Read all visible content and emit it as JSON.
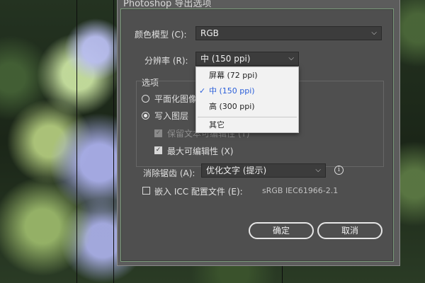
{
  "window": {
    "title": "Photoshop 导出选项"
  },
  "color_model": {
    "label": "颜色模型 (C):",
    "value": "RGB"
  },
  "resolution": {
    "label": "分辨率 (R):",
    "value": "中 (150 ppi)"
  },
  "options": {
    "title": "选项",
    "flatten_label": "平面化图像",
    "write_layers_label": "写入图层",
    "preserve_text_label": "保留文本可编辑性 (T)",
    "max_edit_label": "最大可编辑性 (X)"
  },
  "antialias": {
    "label": "消除锯齿 (A):",
    "value": "优化文字 (提示)"
  },
  "icc": {
    "label": "嵌入 ICC 配置文件 (E):",
    "profile": "sRGB IEC61966-2.1"
  },
  "buttons": {
    "ok": "确定",
    "cancel": "取消"
  },
  "dropdown": {
    "items": [
      {
        "label": "屏幕 (72 ppi)"
      },
      {
        "label": "中 (150 ppi)"
      },
      {
        "label": "高 (300 ppi)"
      },
      {
        "label": "其它"
      }
    ]
  },
  "colors": {
    "accent": "#2b5fd9",
    "dialog_bg": "#4f4f4f"
  },
  "icons": {
    "chevron": "chevron-down-icon",
    "check": "check-icon",
    "info": "info-icon"
  }
}
